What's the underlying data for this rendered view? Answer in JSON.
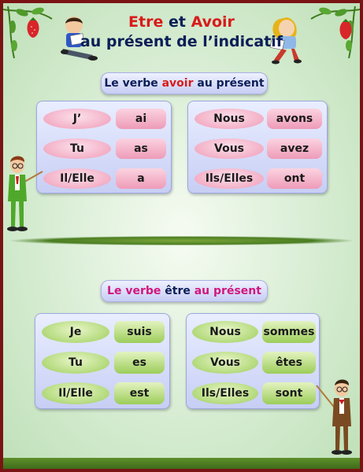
{
  "title": {
    "word1": "Etre",
    "and": " et ",
    "word2": "Avoir",
    "line2": "au présent de l’indicatif"
  },
  "avoir_section": {
    "label_pre": "Le verbe ",
    "label_verb": "avoir",
    "label_post": " au présent",
    "singular": [
      {
        "pronoun": "J’",
        "verb": "ai"
      },
      {
        "pronoun": "Tu",
        "verb": "as"
      },
      {
        "pronoun": "Il/Elle",
        "verb": "a"
      }
    ],
    "plural": [
      {
        "pronoun": "Nous",
        "verb": "avons"
      },
      {
        "pronoun": "Vous",
        "verb": "avez"
      },
      {
        "pronoun": "Ils/Elles",
        "verb": "ont"
      }
    ]
  },
  "etre_section": {
    "label_pre": "Le verbe ",
    "label_verb": "être",
    "label_post": " au présent",
    "singular": [
      {
        "pronoun": "Je",
        "verb": "suis"
      },
      {
        "pronoun": "Tu",
        "verb": "es"
      },
      {
        "pronoun": "Il/Elle",
        "verb": "est"
      }
    ],
    "plural": [
      {
        "pronoun": "Nous",
        "verb": "sommes"
      },
      {
        "pronoun": "Vous",
        "verb": "êtes"
      },
      {
        "pronoun": "Ils/Elles",
        "verb": "sont"
      }
    ]
  },
  "colors": {
    "border": "#7a1414",
    "title_red": "#d81b1b",
    "title_navy": "#0b1e58",
    "etre_magenta": "#d1177e",
    "avoir_pills": "#f09ab7",
    "etre_pills": "#9ccd5a"
  },
  "illustrations": [
    "strawberry-vine-left",
    "strawberry-vine-right",
    "reading-boy",
    "reading-girl",
    "teacher-with-pointer-left",
    "teacher-with-pointer-right"
  ]
}
